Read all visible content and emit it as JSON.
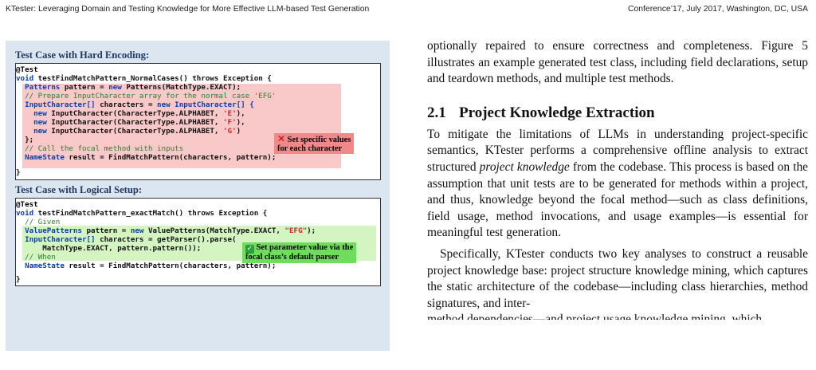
{
  "header": {
    "left": "KTester: Leveraging Domain and Testing Knowledge for More Effective LLM-based Test Generation",
    "right": "Conference’17, July 2017, Washington, DC, USA"
  },
  "figure": {
    "hard_title": "Test Case with Hard Encoding:",
    "hard_code": {
      "l1": "@Test",
      "l2_kw": "void",
      "l2_rest": " testFindMatchPattern_NormalCases() throws Exception {",
      "l3_a": "  Patterns",
      "l3_b": " pattern = ",
      "l3_c": "new",
      "l3_d": " Patterns(MatchType.EXACT);",
      "l4": "  // Prepare InputCharacter array for the normal case 'EFG'",
      "l5_a": "  InputCharacter[]",
      "l5_b": " characters = ",
      "l5_c": "new",
      "l5_d": " InputCharacter[] {",
      "l6_a": "    new",
      "l6_b": " InputCharacter(CharacterType.ALPHABET, ",
      "l6_c": "'E'",
      "l6_d": "),",
      "l7_a": "    new",
      "l7_b": " InputCharacter(CharacterType.ALPHABET, ",
      "l7_c": "'F'",
      "l7_d": "),",
      "l8_a": "    new",
      "l8_b": " InputCharacter(CharacterType.ALPHABET, ",
      "l8_c": "'G'",
      "l8_d": ")",
      "l9": "  };",
      "l10": "  // Call the focal method with inputs",
      "l11_a": "  NameState",
      "l11_b": " result = FindMatchPattern(characters, pattern);",
      "l12": "}"
    },
    "hard_note_line1": "Set specific values",
    "hard_note_line2": "for each character",
    "logic_title": "Test Case with Logical Setup:",
    "logic_code": {
      "l1": "@Test",
      "l2_kw": "void",
      "l2_rest": " testFindMatchPattern_exactMatch() throws Exception {",
      "l3": "  // Given",
      "l4_a": "  ValuePatterns",
      "l4_b": " pattern = ",
      "l4_c": "new",
      "l4_d": " ValuePatterns(MatchType.EXACT, ",
      "l4_e": "\"EFG\"",
      "l4_f": ");",
      "l5_a": "  InputCharacter[]",
      "l5_b": " characters = getParser().parse(",
      "l6": "      MatchType.EXACT, pattern.pattern());",
      "l7": "  // When",
      "l8_a": "  NameState",
      "l8_b": " result = FindMatchPattern(characters, pattern);",
      "l9": "}"
    },
    "logic_note_line1": "Set parameter value via the",
    "logic_note_line2": "focal class’s default parser",
    "icons": {
      "hard_note": "cross-mark-icon",
      "logic_note": "check-mark-icon"
    },
    "colors": {
      "panel_bg": "#dce6f1",
      "pink_highlight": "#f9c8c8",
      "green_highlight": "#d4f5c2",
      "red_note": "#f08a8a",
      "green_note": "#6fdc5e",
      "heading": "#1f3864"
    }
  },
  "body": {
    "para1": "optionally repaired to ensure correctness and completeness. Figure 5 illustrates an example generated test class, including field declarations, setup and teardown methods, and multiple test methods.",
    "section_number": "2.1",
    "section_title": "Project Knowledge Extraction",
    "para2_a": "To mitigate the limitations of LLMs in understanding project-specific semantics, KTester performs a comprehensive offline analysis to extract structured ",
    "para2_em": "project knowledge",
    "para2_b": " from the codebase. This process is based on the assumption that unit tests are to be generated for methods within a project, and thus, knowledge beyond the focal method—such as class definitions, field usage, method invocations, and usage examples—is essential for meaningful test generation.",
    "para3": "Specifically, KTester conducts two key analyses to construct a reusable project knowledge base: project structure knowledge mining, which captures the static architecture of the codebase—including class hierarchies, method signatures, and inter-",
    "para3_cut": "method dependencies—and project usage knowledge mining, which"
  }
}
